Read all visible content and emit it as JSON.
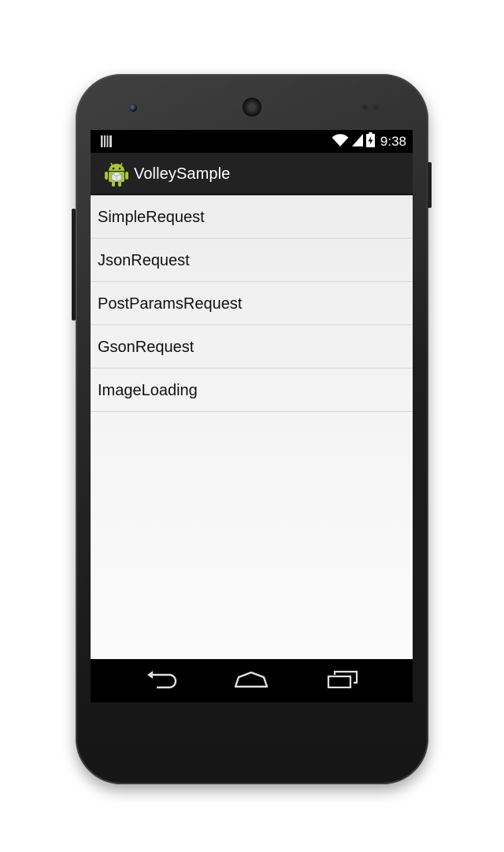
{
  "status_bar": {
    "time": "9:38",
    "notification_icon": "notification-icon",
    "wifi_icon": "wifi-icon",
    "signal_icon": "signal-icon",
    "battery_icon": "battery-icon"
  },
  "action_bar": {
    "title": "VolleySample",
    "app_icon": "android-robot-icon"
  },
  "list": {
    "items": [
      {
        "label": "SimpleRequest"
      },
      {
        "label": "JsonRequest"
      },
      {
        "label": "PostParamsRequest"
      },
      {
        "label": "GsonRequest"
      },
      {
        "label": "ImageLoading"
      }
    ]
  },
  "nav_bar": {
    "back_icon": "back-icon",
    "home_icon": "home-icon",
    "recents_icon": "recents-icon"
  },
  "colors": {
    "action_bar_bg": "#222222",
    "status_bar_bg": "#000000",
    "list_bg": "#f0f0f0",
    "android_green": "#a4c639"
  }
}
